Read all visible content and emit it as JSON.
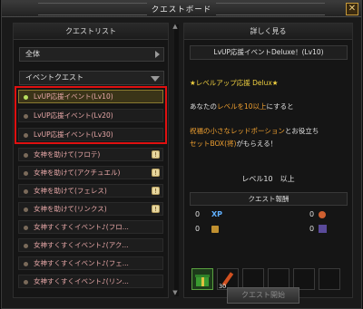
{
  "window": {
    "title": "クエストボード",
    "close_label": "✕"
  },
  "left": {
    "header": "クエストリスト",
    "filter1": "全体",
    "filter2": "イベントクエスト",
    "items": [
      {
        "label": "LvUP応援イベント(Lv10)",
        "selected": true
      },
      {
        "label": "LvUP応援イベント(Lv20)"
      },
      {
        "label": "LvUP応援イベント(Lv30)"
      },
      {
        "label": "女神を助けて(フロテ)",
        "tag": "!"
      },
      {
        "label": "女神を助けて(アクチュエル)",
        "tag": "!"
      },
      {
        "label": "女神を助けて(フェレス)",
        "tag": "!"
      },
      {
        "label": "女神を助けて(リンクス)",
        "tag": "!"
      },
      {
        "label": "女神すくすくイベント♪(フロ..."
      },
      {
        "label": "女神すくすくイベント♪(アク..."
      },
      {
        "label": "女神すくすくイベント♪(フェ..."
      },
      {
        "label": "女神すくすくイベント♪(リン..."
      }
    ]
  },
  "right": {
    "header": "詳しく見る",
    "quest_title": "LvUP応援イベントDeluxe！(Lv10)",
    "line1": "★レベルアップ応援 Delux★",
    "line2a": "あなたの",
    "line2b": "レベルを10以上",
    "line2c": "にすると",
    "line3a": "祝福の小さなレッドポーション",
    "line3b": "とお役立ち",
    "line4a": "セットBOX(将)",
    "line4b": "がもらえる！",
    "level_req": "レベル10　以上",
    "reward_header": "クエスト報酬",
    "xp_left": "0",
    "xp_label": "XP",
    "xp_right": "0",
    "gold_left": "0",
    "gold_right": "0",
    "item_count": "30",
    "button": "クエスト開始"
  }
}
